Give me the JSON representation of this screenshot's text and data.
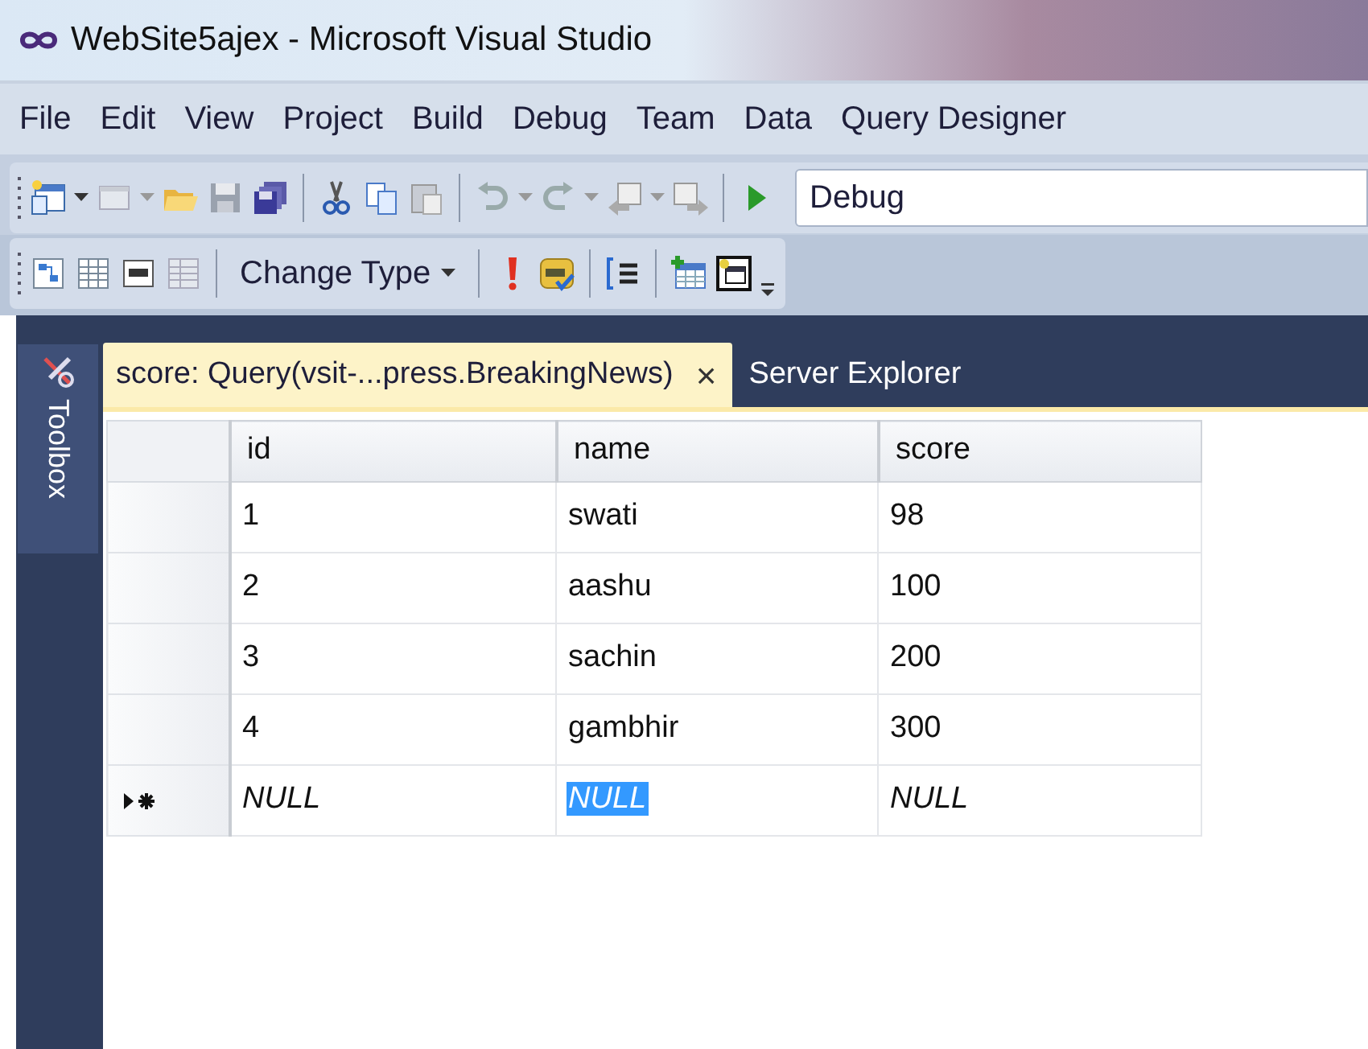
{
  "window": {
    "title": "WebSite5ajex - Microsoft Visual Studio"
  },
  "menu": [
    {
      "label": "File"
    },
    {
      "label": "Edit"
    },
    {
      "label": "View"
    },
    {
      "label": "Project"
    },
    {
      "label": "Build"
    },
    {
      "label": "Debug"
    },
    {
      "label": "Team"
    },
    {
      "label": "Data"
    },
    {
      "label": "Query Designer"
    }
  ],
  "standard_toolbar": {
    "configuration_combo": "Debug"
  },
  "query_toolbar": {
    "change_type": "Change Type"
  },
  "toolbox": {
    "label": "Toolbox"
  },
  "tabs": [
    {
      "label": "score: Query(vsit-...press.BreakingNews)",
      "selected": true,
      "close": "×"
    },
    {
      "label": "Server Explorer",
      "selected": false
    }
  ],
  "grid": {
    "columns": [
      "id",
      "name",
      "score"
    ],
    "rows": [
      {
        "kind": "data",
        "cells": [
          {
            "text": "1",
            "selected": false
          },
          {
            "text": "swati",
            "selected": false
          },
          {
            "text": "98",
            "selected": false
          }
        ]
      },
      {
        "kind": "data",
        "cells": [
          {
            "text": "2",
            "selected": false
          },
          {
            "text": "aashu",
            "selected": false
          },
          {
            "text": "100",
            "selected": false
          }
        ]
      },
      {
        "kind": "data",
        "cells": [
          {
            "text": "3",
            "selected": false
          },
          {
            "text": "sachin",
            "selected": false
          },
          {
            "text": "200",
            "selected": false
          }
        ]
      },
      {
        "kind": "data",
        "cells": [
          {
            "text": "4",
            "selected": false
          },
          {
            "text": "gambhir",
            "selected": false
          },
          {
            "text": "300",
            "selected": false
          }
        ]
      },
      {
        "kind": "new",
        "cells": [
          {
            "text": "NULL",
            "selected": false
          },
          {
            "text": "NULL",
            "selected": true
          },
          {
            "text": "NULL",
            "selected": false
          }
        ]
      }
    ]
  }
}
